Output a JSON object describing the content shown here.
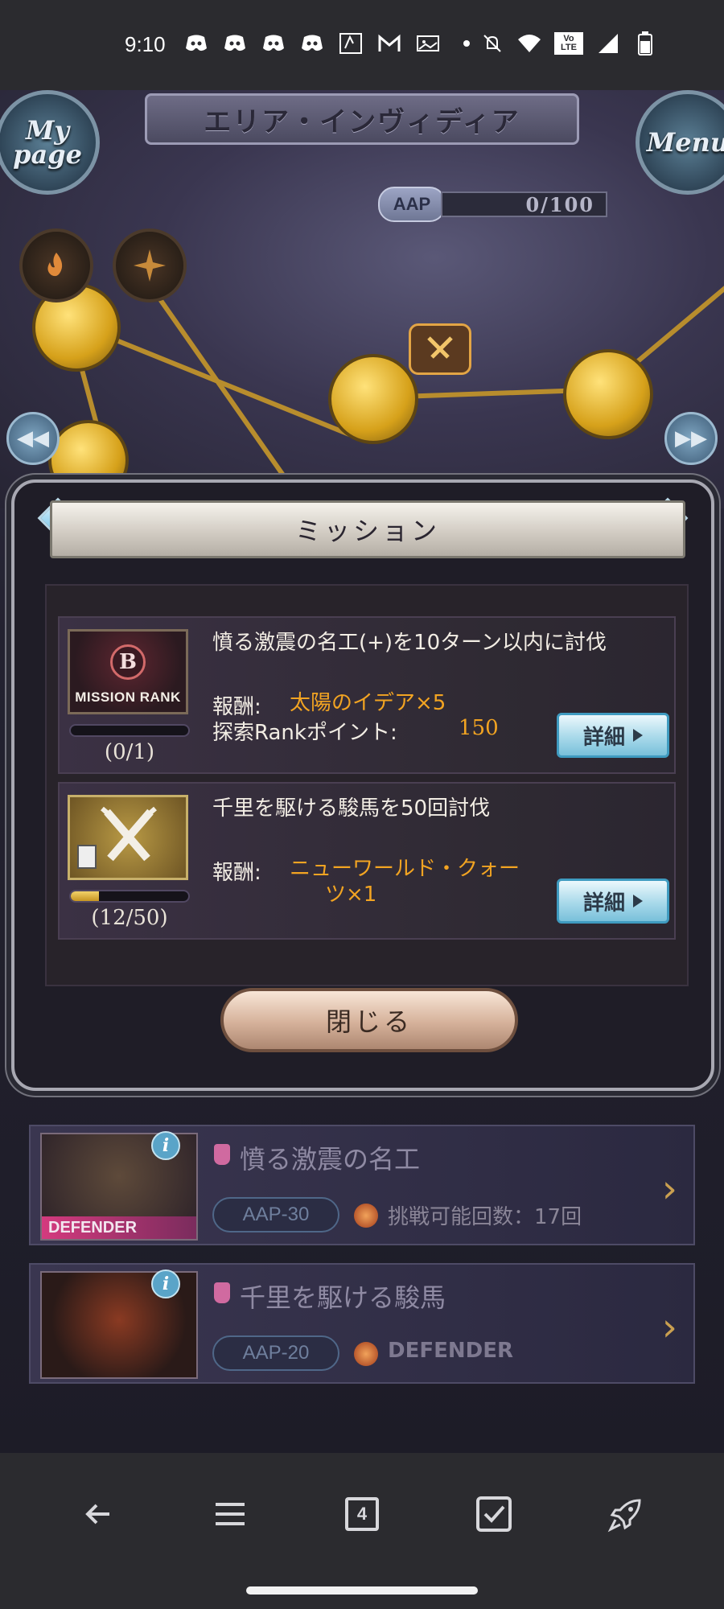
{
  "status_bar": {
    "time": "9:10",
    "notification_icons": [
      "discord-icon",
      "discord-icon",
      "discord-icon",
      "discord-icon",
      "app-icon",
      "gmail-icon",
      "photo-icon",
      "dot-icon"
    ],
    "right_icons": [
      "mute-icon",
      "wifi-icon",
      "volte-icon",
      "signal-icon",
      "battery-icon"
    ],
    "volte_label": "Vo LTE"
  },
  "game_header": {
    "area_title": "エリア・インヴィディア",
    "left_button": "My page",
    "right_button": "Menu",
    "aap_label": "AAP",
    "aap_value": "0/100"
  },
  "mission_modal": {
    "title": "ミッション",
    "missions": [
      {
        "title": "憤る激震の名工(+)を10ターン以内に討伐",
        "rank_letter": "B",
        "rank_label": "MISSION RANK",
        "progress": 0,
        "count": "(0/1)",
        "reward_label": "報酬:",
        "reward_value": "太陽のイデア×5",
        "points_label": "探索Rankポイント:",
        "points_value": "150",
        "detail_label": "詳細"
      },
      {
        "title": "千里を駆ける駿馬を50回討伐",
        "progress": 0.24,
        "count": "(12/50)",
        "reward_label": "報酬:",
        "reward_value_line1": "ニューワールド・クォー",
        "reward_value_line2": "ツ×1",
        "detail_label": "詳細"
      }
    ],
    "close_label": "閉じる"
  },
  "quests": [
    {
      "name": "憤る激震の名工",
      "badge": "DEFENDER",
      "aap": "AAP-30",
      "meta": "挑戦可能回数：17回"
    },
    {
      "name": "千里を駆ける駿馬",
      "aap": "AAP-20",
      "meta": "DEFENDER"
    }
  ],
  "nav_bar": {
    "items": [
      "back-icon",
      "menu-icon",
      "tabs-icon",
      "checkbox-icon",
      "rocket-icon"
    ],
    "tabs_count": "4"
  },
  "colors": {
    "reward_orange": "#f2a422",
    "detail_button": "#a8d9ea",
    "map_gold": "#d6a11a"
  }
}
